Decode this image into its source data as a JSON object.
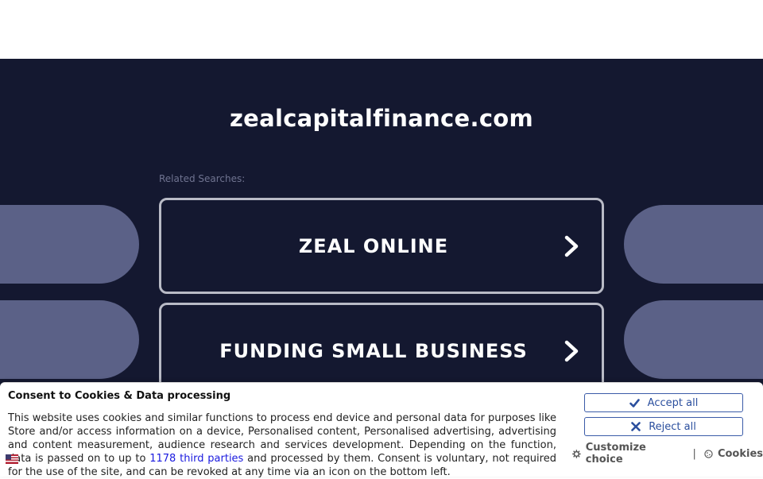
{
  "page": {
    "domain": "zealcapitalfinance.com",
    "related_label": "Related Searches:"
  },
  "searches": [
    {
      "label": "ZEAL ONLINE",
      "icon": "chevron-right-icon"
    },
    {
      "label": "FUNDING SMALL BUSINESS",
      "icon": "chevron-right-icon"
    }
  ],
  "colors": {
    "background": "#141830",
    "pill": "#5b6187",
    "button_border": "#b9bbc6",
    "consent_accent": "#2b4f9e"
  },
  "consent": {
    "title": "Consent to Cookies & Data processing",
    "text_before_link": "This website uses cookies and similar functions to process end device and personal data for purposes like Store and/or access information on a device, Personalised content, Personalised advertising, advertising and content measurement, audience research and services development. Depending on the function, data is passed on to up to ",
    "link_text": "1178 third parties",
    "text_after_link": " and processed by them. Consent is voluntary, not required for the use of the site, and can be revoked at any time via an icon on the bottom left.",
    "accept_label": "Accept all",
    "reject_label": "Reject all",
    "customize_label": "Customize choice",
    "separator": "|",
    "cookies_label": "Cookies"
  }
}
